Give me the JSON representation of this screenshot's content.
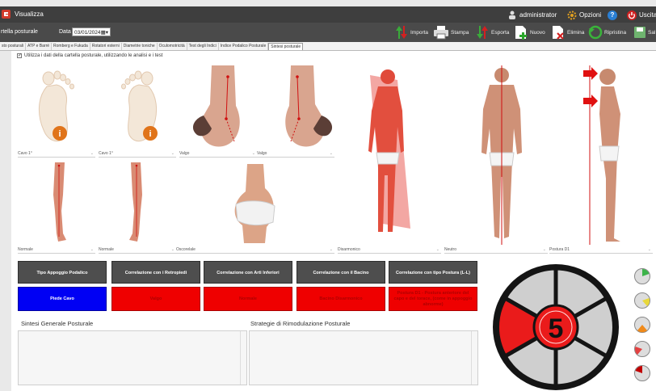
{
  "titlebar": {
    "title": "Visualizza",
    "user": "administrator",
    "options": "Opzioni",
    "help": "?",
    "exit": "Uscita"
  },
  "toolbar": {
    "section": "rtella posturale",
    "date_label": "Data",
    "date_value": "03/01/2024",
    "buttons": [
      "Importa",
      "Stampa",
      "Esporta",
      "Nuovo",
      "Elimina",
      "Ripristina",
      "Sal"
    ]
  },
  "tabs": [
    "sto posturali",
    "ATP e Barré",
    "Romberg e Fukuda",
    "Rotatori esterni",
    "Diametrie toniche",
    "Oculomotricità",
    "Test degli Indici",
    "Indice Podalico Posturale",
    "Sintesi posturale"
  ],
  "checkbox_label": "Utilizza i dati della cartella posturale, utilizzando le analisi e i test",
  "dropdowns_row1": [
    "Cavo 1°",
    "Cavo 1°",
    "Valgo",
    "Valgo"
  ],
  "dropdowns_row2": [
    "Normale",
    "Normale",
    "Oscorelale",
    "Disarmonico",
    "Neutro",
    "Postura D1"
  ],
  "header_buttons": [
    "Tipo Appoggio Podalico",
    "Correlazione con i Retropiedi",
    "Correlazione con Arti Inferiori",
    "Correlazione con il Bacino",
    "Correlazione con tipo Postura (L-L)"
  ],
  "result_buttons": [
    "Piede Cavo",
    "Valgo",
    "Normale",
    "Bacino Disarmonico",
    "Postura D1 - Postura anteriore del capo e del torace, (come in appoggio abnorme)"
  ],
  "result_colors": [
    "#0000f4",
    "#ef0000",
    "#ef0000",
    "#ef0000",
    "#ef0000"
  ],
  "sections": {
    "left": "Sintesi Generale Posturale",
    "right": "Strategie di Rimodulazione Posturale"
  },
  "score": "5",
  "status_colors": [
    "#3cb34a",
    "#e8d83a",
    "#f08a1a",
    "#e34141",
    "#c10000"
  ]
}
